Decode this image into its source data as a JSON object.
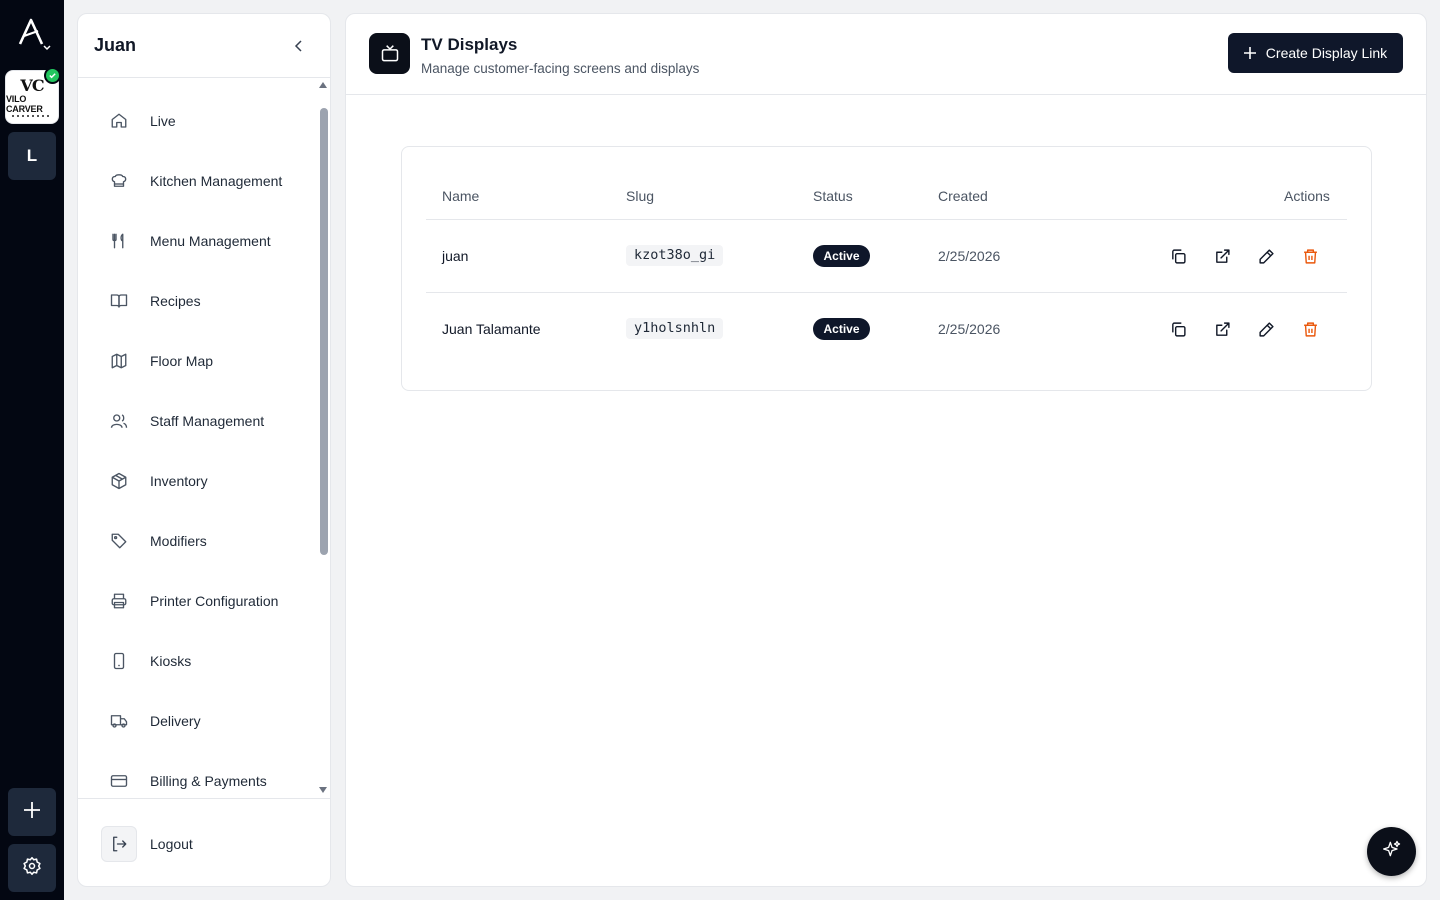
{
  "rail": {
    "store": {
      "monogram": "VC",
      "name": "VILO CARVER"
    },
    "workspace_letter": "L"
  },
  "sidebar": {
    "title": "Juan",
    "items": [
      {
        "label": "Live",
        "icon": "home-icon"
      },
      {
        "label": "Kitchen Management",
        "icon": "chef-hat-icon"
      },
      {
        "label": "Menu Management",
        "icon": "utensils-icon"
      },
      {
        "label": "Recipes",
        "icon": "book-open-icon"
      },
      {
        "label": "Floor Map",
        "icon": "map-icon"
      },
      {
        "label": "Staff Management",
        "icon": "users-icon"
      },
      {
        "label": "Inventory",
        "icon": "package-icon"
      },
      {
        "label": "Modifiers",
        "icon": "tag-icon"
      },
      {
        "label": "Printer Configuration",
        "icon": "printer-icon"
      },
      {
        "label": "Kiosks",
        "icon": "tablet-icon"
      },
      {
        "label": "Delivery",
        "icon": "truck-icon"
      },
      {
        "label": "Billing & Payments",
        "icon": "credit-card-icon"
      }
    ],
    "logout_label": "Logout"
  },
  "header": {
    "title": "TV Displays",
    "subtitle": "Manage customer-facing screens and displays",
    "create_label": "Create Display Link"
  },
  "table": {
    "columns": [
      "Name",
      "Slug",
      "Status",
      "Created",
      "Actions"
    ],
    "rows": [
      {
        "name": "juan",
        "slug": "kzot38o_gi",
        "status": "Active",
        "created": "2/25/2026"
      },
      {
        "name": "Juan Talamante",
        "slug": "y1holsnhln",
        "status": "Active",
        "created": "2/25/2026"
      }
    ]
  },
  "colors": {
    "dark": "#0f172a",
    "success": "#22c55e",
    "danger": "#ea580c"
  }
}
